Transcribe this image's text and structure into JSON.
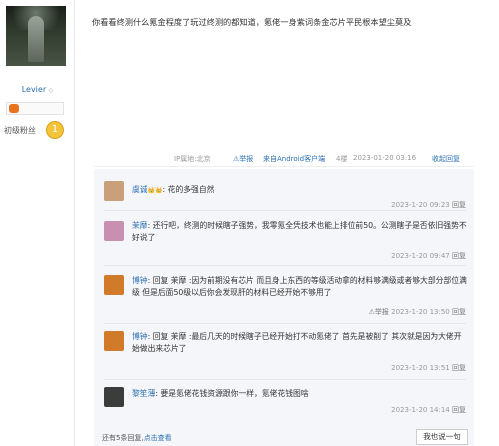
{
  "author": {
    "name": "Levier",
    "rank_glyph": "◇",
    "fan_label": "初级粉丝",
    "fan_badge": "1"
  },
  "post": {
    "text": "你看看终测什么氪金程度了玩过终测的都知道，氪佬一身紫词条金芯片平民根本望尘莫及"
  },
  "meta": {
    "ip": "IP属地:北京",
    "report": "举报",
    "source": "来自Android客户端",
    "floor": "4楼",
    "time": "2023-01-20 03:16",
    "collapse": "收起回复"
  },
  "comments": [
    {
      "user": "虞诚",
      "badge": "👑👑",
      "text": ": 花的多强自然",
      "time": "2023-1-20 09:23",
      "reply": "回复",
      "avatar_color": "#c9a07a"
    },
    {
      "user": "茉靡",
      "badge": "",
      "text": ": 还行吧，终测的时候瞎子强势，我零氪全凭技术也能上排位前50。公测瞎子是否依旧强势不好说了",
      "time": "2023-1-20 09:47",
      "reply": "回复",
      "avatar_color": "#c98fb0"
    },
    {
      "user": "博钟",
      "badge": "",
      "text": ": 回复 茉靡 :因为前期没有芯片 而且身上东西的等级活动拿的材料够满级或者够大部分部位满级 但是后面50级以后你会发现肝的材料已经开始不够用了",
      "time": "2023-1-20 13:50",
      "reply": "回复",
      "report": "举报",
      "avatar_color": "#d07a2a"
    },
    {
      "user": "博钟",
      "badge": "",
      "text": ": 回复 茉靡 :最后几天的时候瞎子已经开始打不动氪佬了 首先是被削了 其次就是因为大佬开始做出来芯片了",
      "time": "2023-1-20 13:51",
      "reply": "回复",
      "avatar_color": "#d07a2a"
    },
    {
      "user": "黎笙薄",
      "badge": "",
      "text": ": 要是氪佬花钱资源跟你一样，氪佬花钱图啥",
      "time": "2023-1-20 14:14",
      "reply": "回复",
      "avatar_color": "#3c3c3c"
    }
  ],
  "footer": {
    "more_text": "还有5条回复,",
    "more_link": "点击查看",
    "say_button": "我也说一句"
  }
}
